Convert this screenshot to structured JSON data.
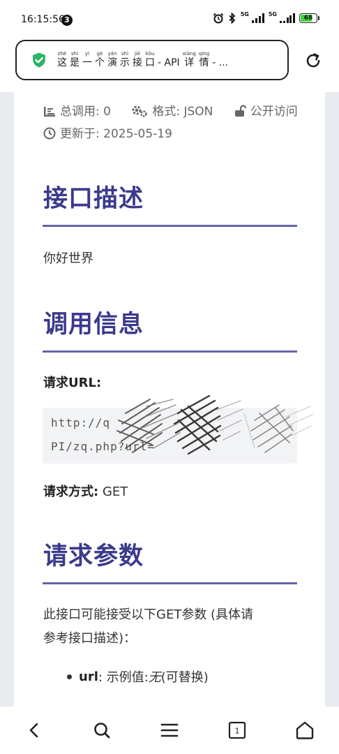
{
  "status_bar": {
    "time": "16:15:56",
    "notification_count": "3",
    "network_1": "5G",
    "network_2": "5G",
    "battery": "68"
  },
  "address_bar": {
    "title_chars": [
      {
        "py": "zhè",
        "hz": "这"
      },
      {
        "py": "shì",
        "hz": "是"
      },
      {
        "py": "yí",
        "hz": "一"
      },
      {
        "py": "gè",
        "hz": "个"
      },
      {
        "py": "yǎn",
        "hz": "演"
      },
      {
        "py": "shì",
        "hz": "示"
      },
      {
        "py": "jiē",
        "hz": "接"
      },
      {
        "py": "kǒu",
        "hz": "口"
      }
    ],
    "title_mid": "- API",
    "title_chars_2": [
      {
        "py": "xiáng",
        "hz": "详"
      },
      {
        "py": "qíng",
        "hz": "情"
      }
    ],
    "title_tail": "- ..."
  },
  "meta": {
    "total_calls": "总调用: 0",
    "format": "格式: JSON",
    "access": "公开访问",
    "updated": "更新于: 2025-05-19"
  },
  "sections": {
    "description_title": "接口描述",
    "description_text": "你好世界",
    "call_info_title": "调用信息",
    "request_url_label": "请求URL:",
    "code_line_1": "http://q",
    "code_line_2": "PI/zq.php?url=",
    "request_method_label": "请求方式:",
    "request_method_value": "GET",
    "params_title": "请求参数",
    "params_intro_1": "此接口可能接受以下GET参数 (具体请",
    "params_intro_2": "参考接口描述)：",
    "param_name": "url",
    "param_example_label": ": 示例值: ",
    "param_example_value": "无",
    "param_note": " (可替换)"
  },
  "bottom_nav": {
    "tab_count": "1"
  },
  "colors": {
    "heading": "#3b3a8c",
    "rule": "#6466a6",
    "shield": "#2fb36b",
    "battery": "#3ed43e"
  }
}
